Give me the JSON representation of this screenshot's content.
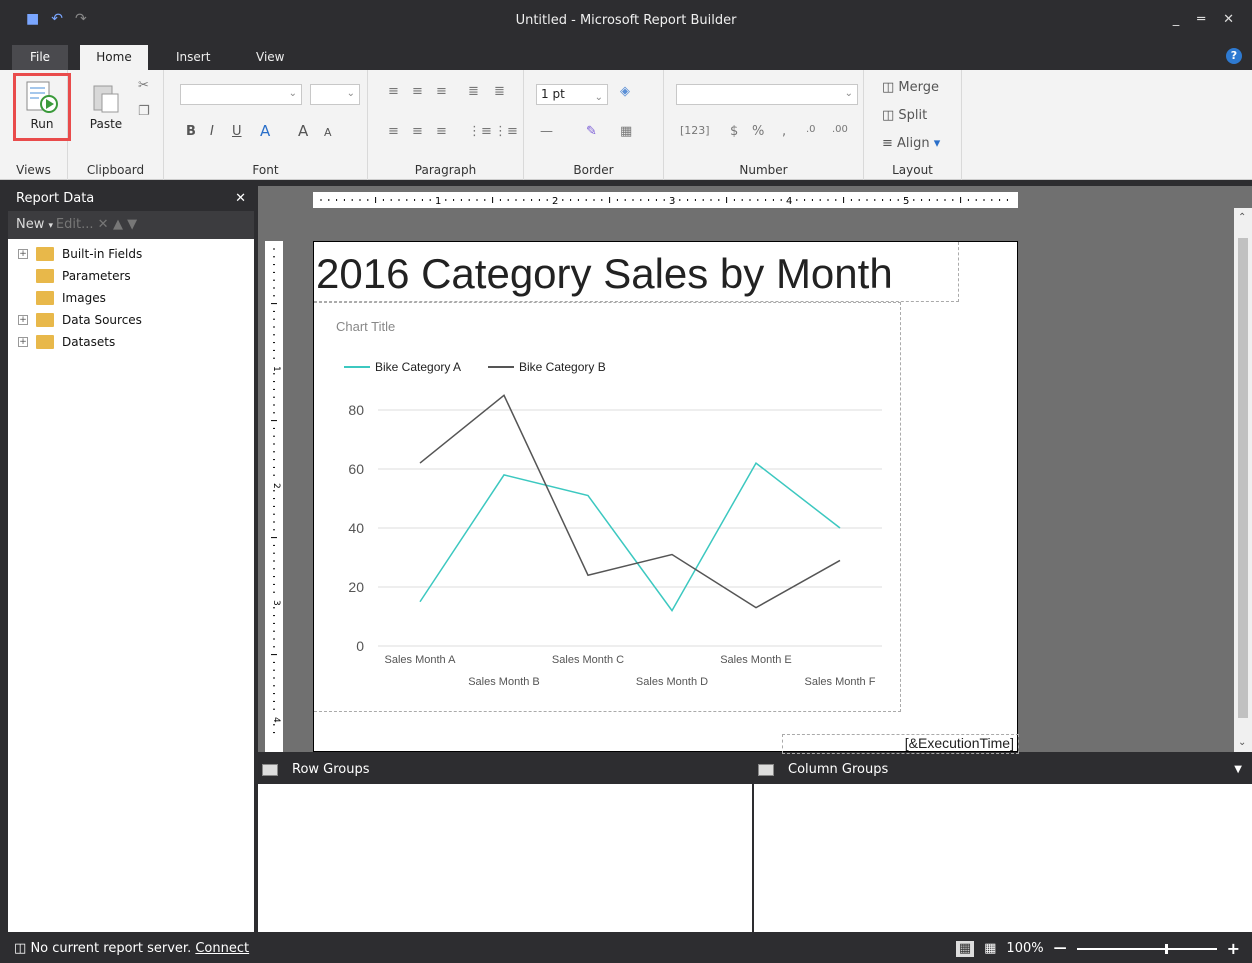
{
  "window": {
    "title": "Untitled - Microsoft Report Builder"
  },
  "tabs": {
    "file": "File",
    "home": "Home",
    "insert": "Insert",
    "view": "View"
  },
  "ribbon": {
    "run_label": "Run",
    "paste_label": "Paste",
    "font_size_value": "1 pt",
    "merge_label": "Merge",
    "split_label": "Split",
    "align_label": "Align",
    "groups": {
      "views": "Views",
      "clipboard": "Clipboard",
      "font": "Font",
      "paragraph": "Paragraph",
      "border": "Border",
      "number": "Number",
      "layout": "Layout"
    }
  },
  "report_data": {
    "header": "Report Data",
    "new_label": "New",
    "edit_label": "Edit...",
    "items": [
      {
        "label": "Built-in Fields",
        "expandable": true
      },
      {
        "label": "Parameters",
        "expandable": false
      },
      {
        "label": "Images",
        "expandable": false
      },
      {
        "label": "Data Sources",
        "expandable": true
      },
      {
        "label": "Datasets",
        "expandable": true
      }
    ]
  },
  "report": {
    "title": "2016 Category Sales by Month",
    "execution_time": "[&ExecutionTime]"
  },
  "chart_data": {
    "type": "line",
    "title": "Chart Title",
    "categories": [
      "Sales Month A",
      "Sales Month B",
      "Sales Month C",
      "Sales Month D",
      "Sales Month E",
      "Sales Month F"
    ],
    "series": [
      {
        "name": "Bike Category A",
        "values": [
          15,
          58,
          51,
          12,
          62,
          40
        ],
        "color": "#3cc8c0"
      },
      {
        "name": "Bike Category B",
        "values": [
          62,
          85,
          24,
          31,
          13,
          29
        ],
        "color": "#555555"
      }
    ],
    "yticks": [
      "0",
      "20",
      "40",
      "60",
      "80"
    ],
    "ylim": [
      0,
      80
    ],
    "grid": true,
    "legend": "top-left"
  },
  "groups": {
    "row": "Row Groups",
    "column": "Column Groups"
  },
  "status": {
    "server_text": "No current report server.",
    "connect_link": "Connect",
    "zoom": "100%"
  }
}
